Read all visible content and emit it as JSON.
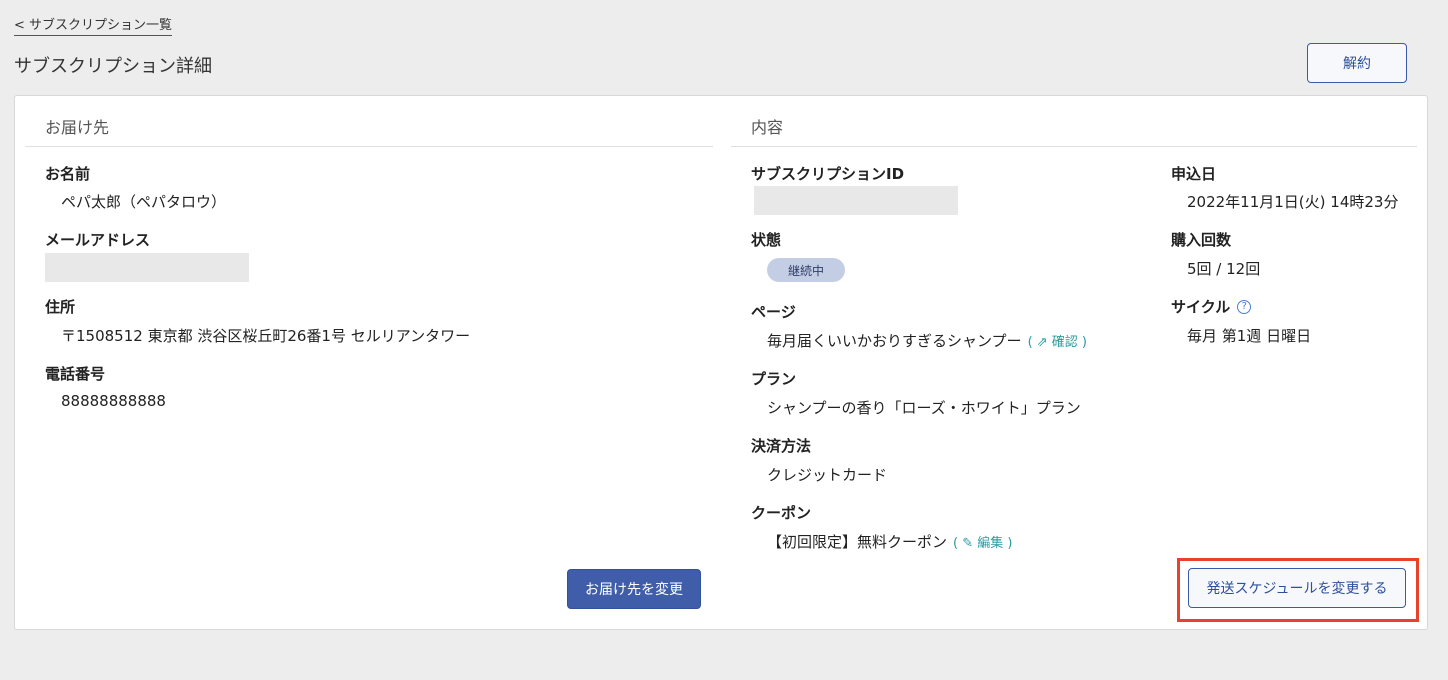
{
  "header": {
    "back_link": "< サブスクリプション一覧",
    "title": "サブスクリプション詳細",
    "cancel_label": "解約"
  },
  "delivery": {
    "heading": "お届け先",
    "name_label": "お名前",
    "name_value": "ペパ太郎（ペパタロウ）",
    "email_label": "メールアドレス",
    "address_label": "住所",
    "address_value": "〒1508512 東京都 渋谷区桜丘町26番1号 セルリアンタワー",
    "phone_label": "電話番号",
    "phone_value": "88888888888",
    "change_button": "お届け先を変更"
  },
  "content": {
    "heading": "内容",
    "id_label": "サブスクリプションID",
    "status_label": "状態",
    "status_value": "継続中",
    "page_label": "ページ",
    "page_value": "毎月届くいいかおりすぎるシャンプー",
    "page_link": "( ⇗ 確認 )",
    "plan_label": "プラン",
    "plan_value": "シャンプーの香り「ローズ・ホワイト」プラン",
    "payment_label": "決済方法",
    "payment_value": "クレジットカード",
    "coupon_label": "クーポン",
    "coupon_value": "【初回限定】無料クーポン",
    "coupon_link": "( ✎ 編集 )",
    "applied_label": "申込日",
    "applied_value": "2022年11月1日(火) 14時23分",
    "count_label": "購入回数",
    "count_value": "5回 / 12回",
    "cycle_label": "サイクル",
    "cycle_help": "?",
    "cycle_value": "毎月 第1週 日曜日",
    "schedule_button": "発送スケジュールを変更する"
  }
}
